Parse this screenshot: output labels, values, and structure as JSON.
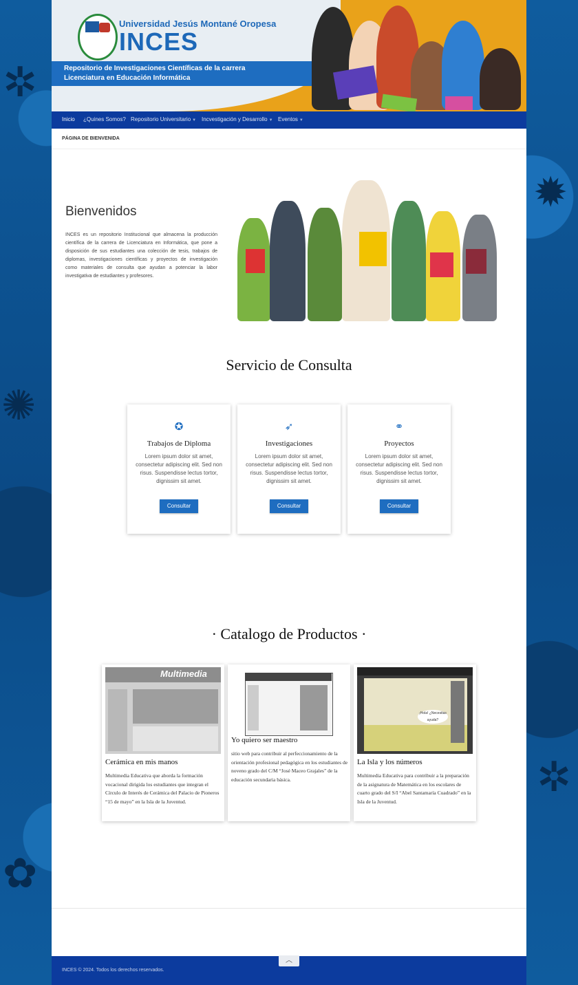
{
  "header": {
    "university": "Universidad Jesús Montané Oropesa",
    "brand": "INCES",
    "tagline_line1": "Repositorio de Investigaciones Científicas de la carrera",
    "tagline_line2": "Licenciatura en Educación Informática"
  },
  "nav": {
    "items": [
      {
        "label": "Inicio"
      },
      {
        "label": "¿Quines Somos?"
      },
      {
        "label": "Repositorio Universitario"
      },
      {
        "label": "Incvestigación y Desarrollo"
      },
      {
        "label": "Eventos"
      }
    ]
  },
  "breadcrumb": "PÁGINA DE BIENVENIDA",
  "welcome": {
    "title": "Bienvenidos",
    "text": "INCES es un repositorio Institucional que almacena la  producción científica de la carrera de Licenciatura en Informática, que pone a disposición de sus estudiantes una colección de tesis, trabajos de diplomas, investigaciones científicas y proyectos de investigación como materiales de consulta que ayudan a potenciar la labor investigativa de estudiantes y profesores."
  },
  "services": {
    "title": "Servicio de Consulta",
    "cards": [
      {
        "icon": "award-icon",
        "title": "Trabajos de Diploma",
        "text": "Lorem ipsum dolor sit amet, consectetur adipiscing elit. Sed non risus. Suspendisse lectus tortor, dignissim sit amet.",
        "button": "Consultar"
      },
      {
        "icon": "rocket-icon",
        "title": "Investigaciones",
        "text": "Lorem ipsum dolor sit amet, consectetur adipiscing elit. Sed non risus. Suspendisse lectus tortor, dignissim sit amet.",
        "button": "Consultar"
      },
      {
        "icon": "handshake-icon",
        "title": "Proyectos",
        "text": "Lorem ipsum dolor sit amet, consectetur adipiscing elit. Sed non risus. Suspendisse lectus tortor, dignissim sit amet.",
        "button": "Consultar"
      }
    ]
  },
  "catalog": {
    "title": "· Catalogo de Productos ·",
    "products": [
      {
        "title": "Cerámica en mis manos",
        "image_text": "Multimedia",
        "text": "Multimedia Educativa que aborda la formación vocacional dirigida los estudiantes que integran el Círculo de Interés de Cerámica del Palacio de Pioneros “15 de mayo” en la Isla de la Juventud."
      },
      {
        "title": "Yo quiero ser maestro",
        "text": "sitio web para contribuir al perfeccionamiento de la orientación profesional pedagógica en los estudiantes de noveno grado del C/M “José Maceo Grajales” de la educación secundaria básica."
      },
      {
        "title": "La Isla y los números",
        "image_text": "¡Hola! ¿Necesitas ayuda?",
        "text": "Multimedia Educativa para contribuir a la preparación de la asignatura de Matemática en los escolares de cuarto grado del S/I “Abel Santamaría Cuadrado” en la Isla de la Juventud."
      }
    ]
  },
  "footer": {
    "copyright": "INCES © 2024. Todos los derechos reservados."
  },
  "colors": {
    "primary": "#1e6dc0",
    "nav": "#0c3b9e",
    "accent": "#e9a21a"
  }
}
